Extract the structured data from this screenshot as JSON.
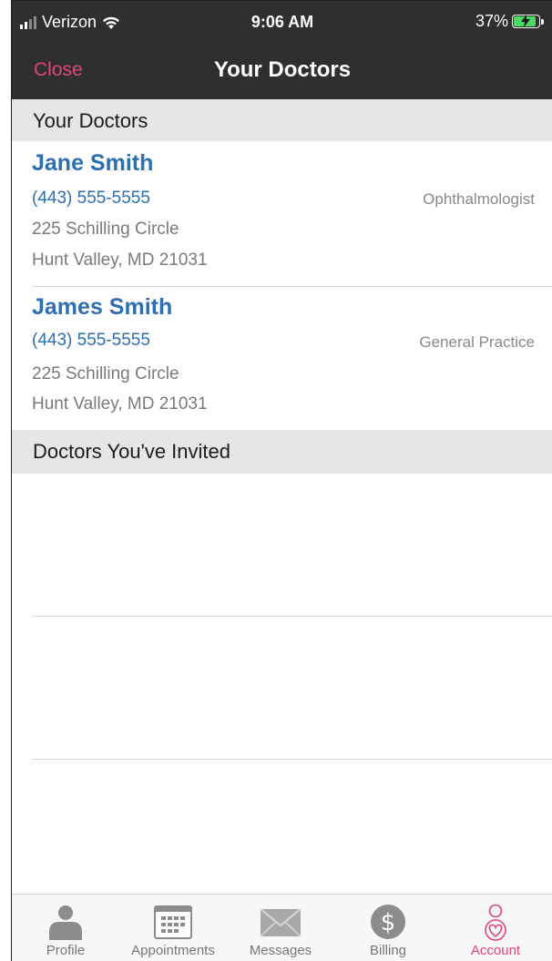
{
  "status_bar": {
    "carrier": "Verizon",
    "time": "9:06 AM",
    "battery": "37%"
  },
  "nav": {
    "close_label": "Close",
    "title": "Your Doctors"
  },
  "sections": {
    "your_doctors": "Your Doctors",
    "invited": "Doctors You've Invited"
  },
  "doctors": [
    {
      "name": "Jane Smith",
      "phone": "(443) 555-5555",
      "specialty": "Ophthalmologist",
      "address1": "225 Schilling Circle",
      "address2": "Hunt Valley, MD 21031"
    },
    {
      "name": "James Smith",
      "phone": "(443) 555-5555",
      "specialty": "General Practice",
      "address1": "225 Schilling Circle",
      "address2": "Hunt Valley, MD 21031"
    }
  ],
  "tabs": [
    {
      "label": "Profile",
      "icon": "person-icon"
    },
    {
      "label": "Appointments",
      "icon": "calendar-icon"
    },
    {
      "label": "Messages",
      "icon": "envelope-icon"
    },
    {
      "label": "Billing",
      "icon": "dollar-icon"
    },
    {
      "label": "Account",
      "icon": "account-heart-icon",
      "active": true
    }
  ],
  "colors": {
    "accent": "#e0457b",
    "link": "#2d6fb0",
    "bar": "#2f2f2f",
    "section_bg": "#e6e6e6"
  }
}
